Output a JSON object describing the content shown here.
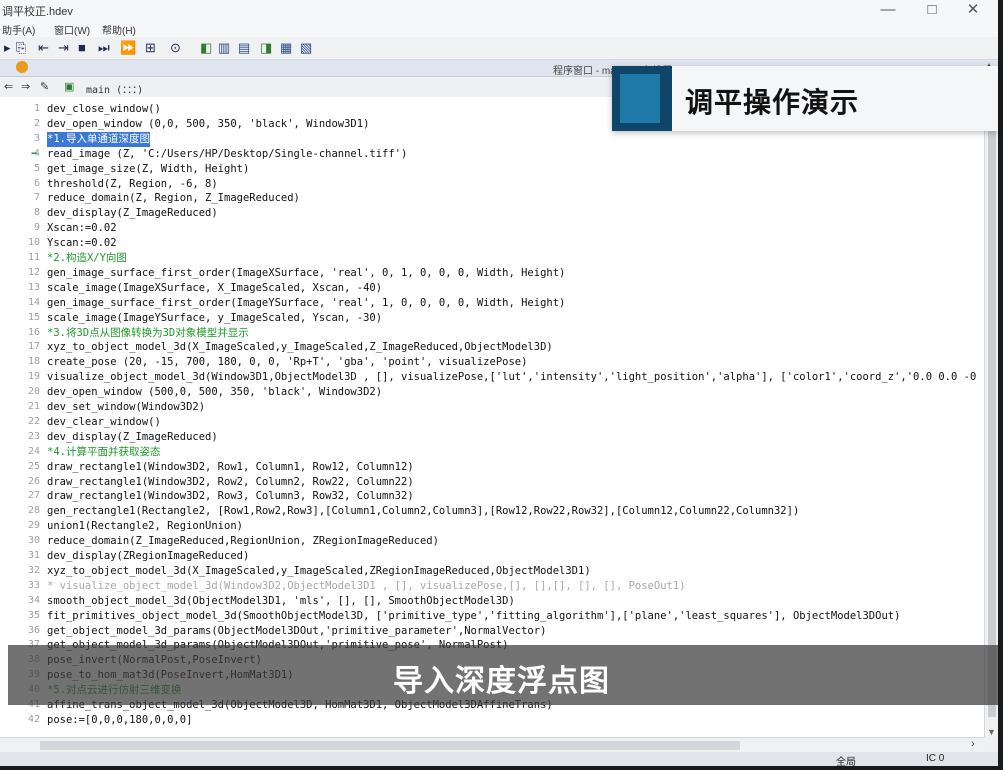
{
  "titlebar": {
    "title": "调平校正.hdev",
    "minimize": "—",
    "maximize": "□",
    "close": "✕"
  },
  "menu": [
    "助手(A)",
    "窗口(W)",
    "帮助(H)"
  ],
  "toolbar": {
    "icons": [
      "step-into-icon",
      "step-over-icon",
      "step-back-icon",
      "stop-icon",
      "run-to-icon",
      "continue-icon",
      "clear-window-icon",
      "reset-icon",
      "inspect-image-icon",
      "graphics-window-icon",
      "line-profile-icon",
      "histogram-icon",
      "gray-histogram-icon",
      "feature-histogram-icon"
    ]
  },
  "program_window": {
    "title": "程序窗口 - main () - 主线程: 11500"
  },
  "nav": {
    "procedure": "main (：：：)"
  },
  "code_lines": [
    {
      "n": "1",
      "text": "dev_close_window()",
      "type": "code"
    },
    {
      "n": "2",
      "text": "dev_open_window (0,0, 500, 350, 'black', Window3D1)",
      "type": "code"
    },
    {
      "n": "3",
      "text": "*1.导入单通道深度图",
      "type": "highlight"
    },
    {
      "n": "4",
      "text": "read_image (Z, 'C:/Users/HP/Desktop/Single-channel.tiff')",
      "type": "code",
      "pc": true
    },
    {
      "n": "5",
      "text": "get_image_size(Z, Width, Height)",
      "type": "code"
    },
    {
      "n": "6",
      "text": "threshold(Z, Region, -6, 8)",
      "type": "code"
    },
    {
      "n": "7",
      "text": "reduce_domain(Z, Region, Z_ImageReduced)",
      "type": "code"
    },
    {
      "n": "8",
      "text": "dev_display(Z_ImageReduced)",
      "type": "code"
    },
    {
      "n": "9",
      "text": "Xscan:=0.02",
      "type": "code"
    },
    {
      "n": "10",
      "text": "Yscan:=0.02",
      "type": "code"
    },
    {
      "n": "11",
      "text": "*2.构造X/Y向图",
      "type": "comment"
    },
    {
      "n": "12",
      "text": "gen_image_surface_first_order(ImageXSurface, 'real', 0, 1, 0, 0, 0, Width, Height)",
      "type": "code"
    },
    {
      "n": "13",
      "text": "scale_image(ImageXSurface, X_ImageScaled, Xscan, -40)",
      "type": "code"
    },
    {
      "n": "14",
      "text": "gen_image_surface_first_order(ImageYSurface, 'real', 1, 0, 0, 0, 0, Width, Height)",
      "type": "code"
    },
    {
      "n": "15",
      "text": "scale_image(ImageYSurface, y_ImageScaled, Yscan, -30)",
      "type": "code"
    },
    {
      "n": "16",
      "text": "*3.将3D点从图像转换为3D对象模型并显示",
      "type": "comment"
    },
    {
      "n": "17",
      "text": "xyz_to_object_model_3d(X_ImageScaled,y_ImageScaled,Z_ImageReduced,ObjectModel3D)",
      "type": "code"
    },
    {
      "n": "18",
      "text": "create_pose (20, -15, 700, 180, 0, 0, 'Rp+T', 'gba', 'point', visualizePose)",
      "type": "code"
    },
    {
      "n": "19",
      "text": "visualize_object_model_3d(Window3D1,ObjectModel3D , [], visualizePose,['lut','intensity','light_position','alpha'], ['color1','coord_z','0.0 0.0 -0",
      "type": "code"
    },
    {
      "n": "20",
      "text": "dev_open_window (500,0, 500, 350, 'black', Window3D2)",
      "type": "code"
    },
    {
      "n": "21",
      "text": "dev_set_window(Window3D2)",
      "type": "code"
    },
    {
      "n": "22",
      "text": "dev_clear_window()",
      "type": "code"
    },
    {
      "n": "23",
      "text": "dev_display(Z_ImageReduced)",
      "type": "code"
    },
    {
      "n": "24",
      "text": "*4.计算平面并获取姿态",
      "type": "comment"
    },
    {
      "n": "25",
      "text": "draw_rectangle1(Window3D2, Row1, Column1, Row12, Column12)",
      "type": "code"
    },
    {
      "n": "26",
      "text": "draw_rectangle1(Window3D2, Row2, Column2, Row22, Column22)",
      "type": "code"
    },
    {
      "n": "27",
      "text": "draw_rectangle1(Window3D2, Row3, Column3, Row32, Column32)",
      "type": "code"
    },
    {
      "n": "28",
      "text": "gen_rectangle1(Rectangle2, [Row1,Row2,Row3],[Column1,Column2,Column3],[Row12,Row22,Row32],[Column12,Column22,Column32])",
      "type": "code"
    },
    {
      "n": "29",
      "text": "union1(Rectangle2, RegionUnion)",
      "type": "code"
    },
    {
      "n": "30",
      "text": "reduce_domain(Z_ImageReduced,RegionUnion, ZRegionImageReduced)",
      "type": "code"
    },
    {
      "n": "31",
      "text": "dev_display(ZRegionImageReduced)",
      "type": "code"
    },
    {
      "n": "32",
      "text": "xyz_to_object_model_3d(X_ImageScaled,y_ImageScaled,ZRegionImageReduced,ObjectModel3D1)",
      "type": "code"
    },
    {
      "n": "33",
      "text": "* visualize_object_model_3d(Window3D2,ObjectModel3D1 , [], visualizePose,[], [],[], [], [], PoseOut1)",
      "type": "disabled"
    },
    {
      "n": "34",
      "text": "smooth_object_model_3d(ObjectModel3D1, 'mls', [], [], SmoothObjectModel3D)",
      "type": "code"
    },
    {
      "n": "35",
      "text": "fit_primitives_object_model_3d(SmoothObjectModel3D, ['primitive_type','fitting_algorithm'],['plane','least_squares'], ObjectModel3DOut)",
      "type": "code"
    },
    {
      "n": "36",
      "text": "get_object_model_3d_params(ObjectModel3DOut,'primitive_parameter',NormalVector)",
      "type": "code"
    },
    {
      "n": "37",
      "text": "get_object_model_3d_params(ObjectModel3DOut,'primitive_pose', NormalPost)",
      "type": "code"
    },
    {
      "n": "38",
      "text": "pose_invert(NormalPost,PoseInvert)",
      "type": "code"
    },
    {
      "n": "39",
      "text": "pose_to_hom_mat3d(PoseInvert,HomMat3D1)",
      "type": "code"
    },
    {
      "n": "40",
      "text": "*5.对点云进行仿射三维变换",
      "type": "comment"
    },
    {
      "n": "41",
      "text": "affine_trans_object_model_3d(ObjectModel3D, HomMat3D1, ObjectModel3DAffineTrans)",
      "type": "code"
    },
    {
      "n": "42",
      "text": "pose:=[0,0,0,180,0,0,0]",
      "type": "code"
    }
  ],
  "status": {
    "left": "全局",
    "right": "IC 0"
  },
  "overlay": {
    "banner": "调平操作演示",
    "subtitle": "导入深度浮点图"
  }
}
